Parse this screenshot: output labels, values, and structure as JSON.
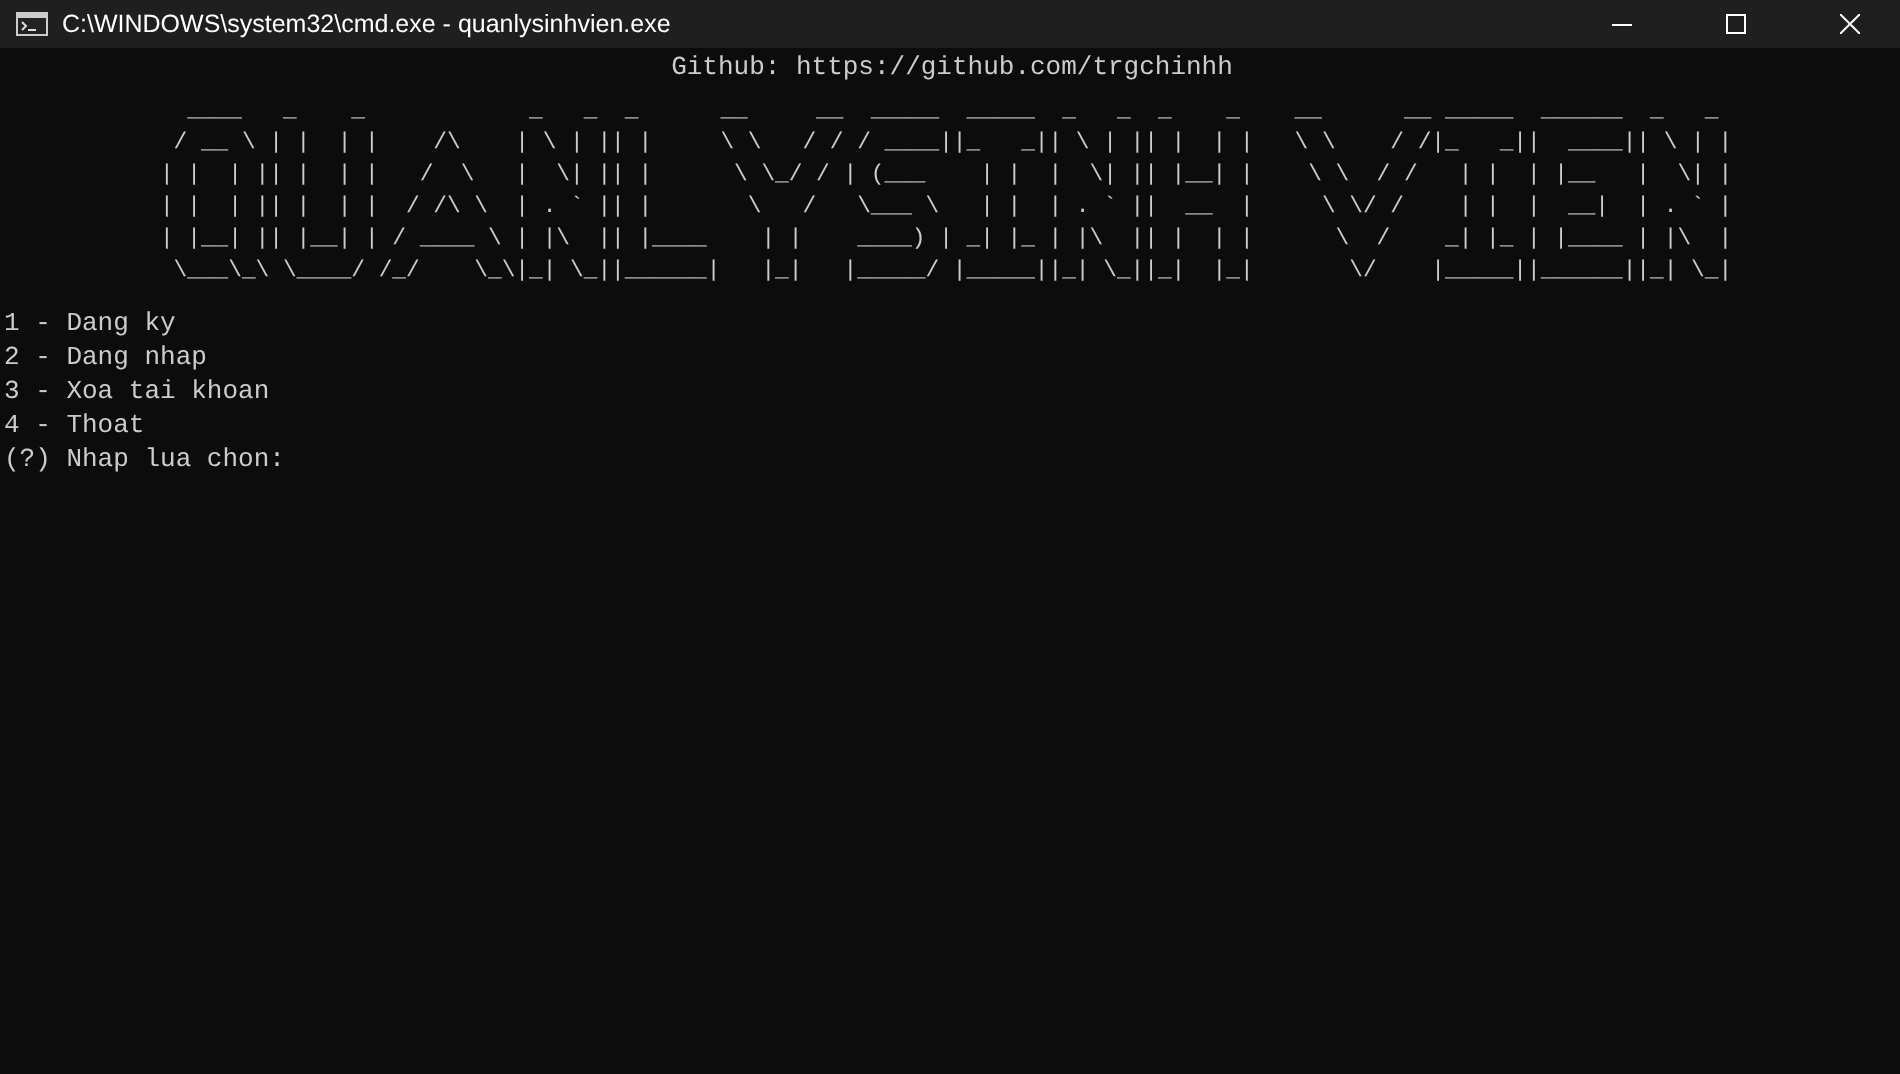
{
  "window": {
    "title": "C:\\WINDOWS\\system32\\cmd.exe - quanlysinhvien.exe"
  },
  "console": {
    "header": "Github: https://github.com/trgchinhh",
    "banner": [
      "  ____   _    _            _   _  _      __     __  _____  _____  _   _  _    _    __      __ _____  ______  _   _ ",
      " / __ \\ | |  | |    /\\    | \\ | || |     \\ \\   / / / ____||_   _|| \\ | || |  | |   \\ \\    / /|_   _||  ____|| \\ | |",
      "| |  | || |  | |   /  \\   |  \\| || |      \\ \\_/ / | (___    | |  |  \\| || |__| |    \\ \\  / /   | |  | |__   |  \\| |",
      "| |  | || |  | |  / /\\ \\  | . ` || |       \\   /   \\___ \\   | |  | . ` ||  __  |     \\ \\/ /    | |  |  __|  | . ` |",
      "| |__| || |__| | / ____ \\ | |\\  || |____    | |    ____) | _| |_ | |\\  || |  | |      \\  /    _| |_ | |____ | |\\  |",
      " \\___\\_\\ \\____/ /_/    \\_\\|_| \\_||______|   |_|   |_____/ |_____||_| \\_||_|  |_|       \\/    |_____||______||_| \\_|"
    ],
    "menu": [
      "1 - Dang ky",
      "2 - Dang nhap",
      "3 - Xoa tai khoan",
      "4 - Thoat"
    ],
    "prompt": "(?) Nhap lua chon:"
  }
}
